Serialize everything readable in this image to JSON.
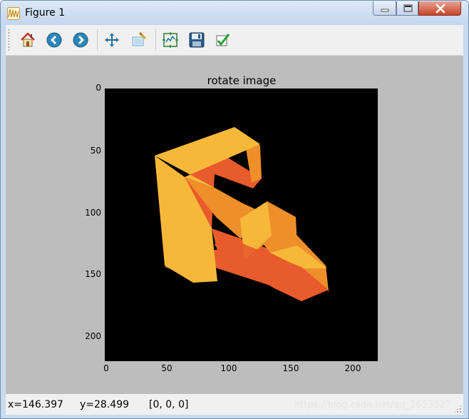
{
  "window": {
    "title": "Figure 1"
  },
  "toolbar": {
    "buttons": [
      {
        "name": "home",
        "icon": "home-icon"
      },
      {
        "name": "back",
        "icon": "back-arrow-icon"
      },
      {
        "name": "forward",
        "icon": "forward-arrow-icon"
      },
      {
        "name": "pan",
        "icon": "move-icon"
      },
      {
        "name": "zoom",
        "icon": "zoom-rect-icon"
      },
      {
        "name": "configure-subplots",
        "icon": "subplots-icon"
      },
      {
        "name": "save",
        "icon": "floppy-disk-icon"
      },
      {
        "name": "edit-parameters",
        "icon": "checkmark-icon"
      }
    ]
  },
  "plot": {
    "title": "rotate image",
    "y_ticks": [
      "0",
      "50",
      "100",
      "150",
      "200"
    ],
    "x_ticks": [
      "0",
      "50",
      "100",
      "150",
      "200"
    ],
    "background": "#000000",
    "colors": {
      "top_face": "#f7b83a",
      "shadow_face": "#e85b2c",
      "side_face": "#ee8f2a"
    }
  },
  "status": {
    "x_readout": "x=146.397",
    "y_readout": "y=28.499",
    "pixel_value": "[0, 0, 0]",
    "watermark": "https://blog.csdn.net/qq_2653527"
  }
}
